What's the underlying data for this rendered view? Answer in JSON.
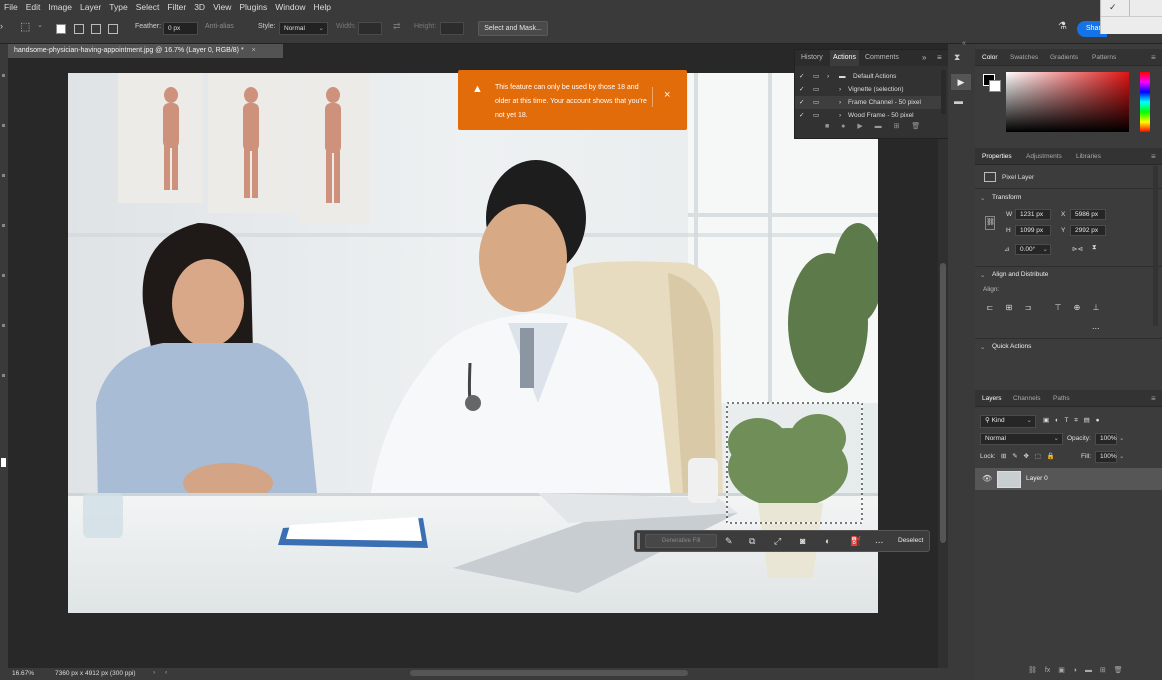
{
  "menu": [
    "File",
    "Edit",
    "Image",
    "Layer",
    "Type",
    "Select",
    "Filter",
    "3D",
    "View",
    "Plugins",
    "Window",
    "Help"
  ],
  "options": {
    "feather_label": "Feather:",
    "feather_value": "0 px",
    "antialias_label": "Anti-alias",
    "style_label": "Style:",
    "style_value": "Normal",
    "width_label": "Width:",
    "height_label": "Height:",
    "select_mask": "Select and Mask...",
    "share": "Share"
  },
  "document_tab": "handsome-physician-having-appointment.jpg @ 16.7% (Layer 0, RGB/8) *",
  "toast": {
    "message": "This feature can only be used by those 18 and older at this time. Your account shows that you're not yet 18.",
    "color": "#e26b0a"
  },
  "history_panel": {
    "tabs": [
      "History",
      "Actions",
      "Comments"
    ],
    "rows": [
      "Default Actions",
      "Vignette (selection)",
      "Frame Channel - 50 pixel",
      "Wood Frame - 50 pixel"
    ]
  },
  "context_bar": {
    "gen_fill": "Generative Fill",
    "deselect": "Deselect",
    "more": "..."
  },
  "color_panel": {
    "tabs": [
      "Color",
      "Swatches",
      "Gradients",
      "Patterns"
    ]
  },
  "properties": {
    "tabs": [
      "Properties",
      "Adjustments",
      "Libraries"
    ],
    "kind": "Pixel Layer",
    "transform_title": "Transform",
    "w_label": "W",
    "w": "1231 px",
    "h_label": "H",
    "h": "1099 px",
    "x_label": "X",
    "x": "5986 px",
    "y_label": "Y",
    "y": "2992 px",
    "angle": "0.00°",
    "align_title": "Align and Distribute",
    "align_label": "Align:",
    "align_more": "...",
    "quick_actions": "Quick Actions"
  },
  "layers": {
    "tabs": [
      "Layers",
      "Channels",
      "Paths"
    ],
    "filter": "Kind",
    "blend": "Normal",
    "opacity_label": "Opacity:",
    "opacity": "100%",
    "lock_label": "Lock:",
    "fill_label": "Fill:",
    "fill": "100%",
    "layer_name": "Layer 0"
  },
  "status": {
    "zoom": "16.67%",
    "doc_info": "7360 px x 4912 px (300 ppi)"
  },
  "colors": {
    "accent": "#1473e6",
    "toast": "#e26b0a"
  }
}
